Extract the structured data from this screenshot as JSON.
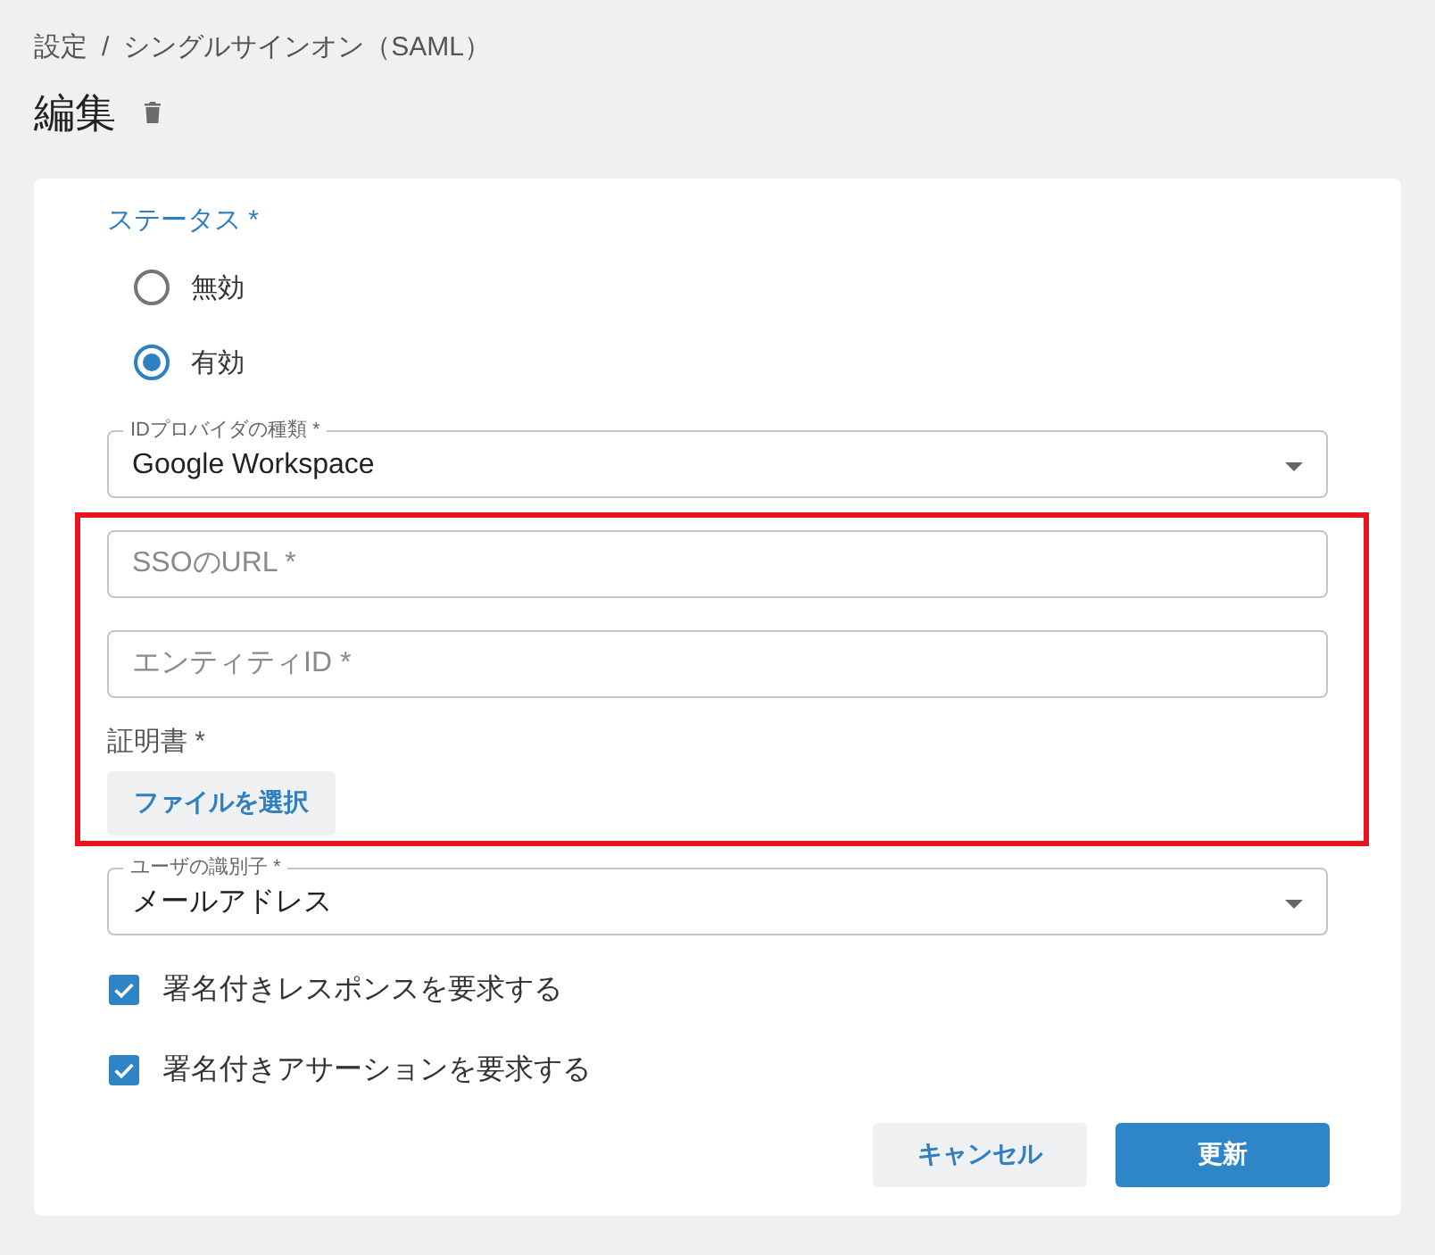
{
  "breadcrumb": {
    "items": [
      "設定",
      "シングルサインオン（SAML）"
    ],
    "separator": "/"
  },
  "page_title": "編集",
  "form": {
    "status": {
      "label": "ステータス *",
      "options": [
        {
          "label": "無効",
          "selected": false
        },
        {
          "label": "有効",
          "selected": true
        }
      ]
    },
    "idp_type": {
      "label": "IDプロバイダの種類 *",
      "value": "Google Workspace"
    },
    "credentials": {
      "highlighted": true,
      "fields": [
        {
          "placeholder": "SSOのURL *"
        },
        {
          "placeholder": "エンティティID *"
        }
      ],
      "certificate": {
        "label": "証明書 *",
        "button": "ファイルを選択"
      }
    },
    "user_identifier": {
      "label": "ユーザの識別子 *",
      "value": "メールアドレス"
    },
    "checkboxes": [
      {
        "label": "署名付きレスポンスを要求する",
        "checked": true
      },
      {
        "label": "署名付きアサーションを要求する",
        "checked": true
      }
    ],
    "buttons": [
      {
        "label": "キャンセル",
        "kind": "secondary"
      },
      {
        "label": "更新",
        "kind": "primary"
      }
    ]
  }
}
